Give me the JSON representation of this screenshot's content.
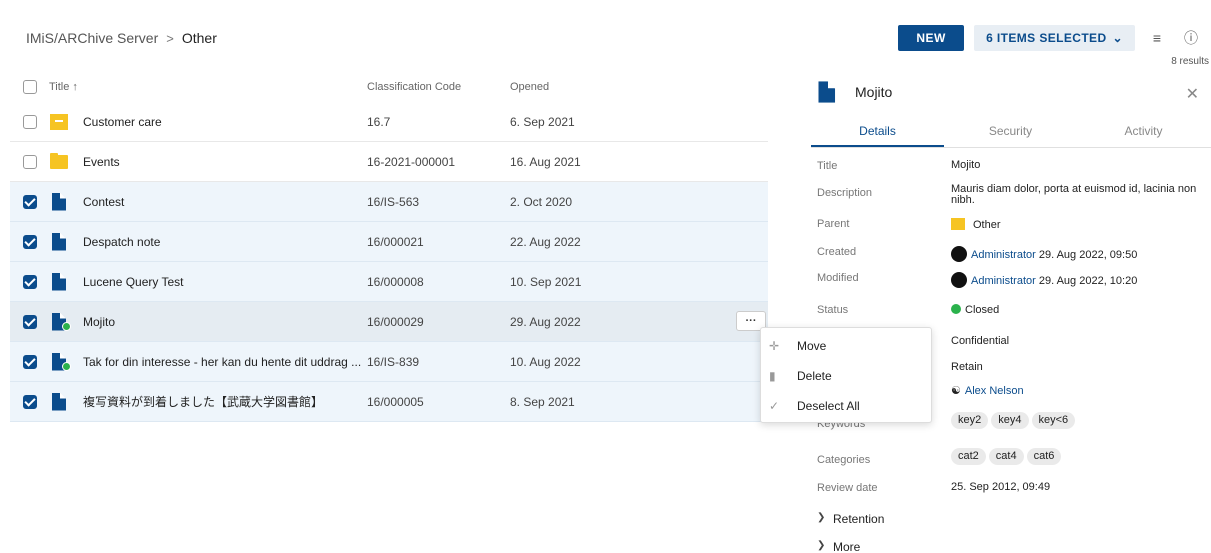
{
  "breadcrumb": {
    "root": "IMiS/ARChive Server",
    "separator": ">",
    "current": "Other"
  },
  "toolbar": {
    "new_label": "NEW",
    "selected_label": "6 ITEMS SELECTED",
    "results": "8 results"
  },
  "table": {
    "headers": {
      "title": "Title ↑",
      "code": "Classification Code",
      "opened": "Opened"
    },
    "rows": [
      {
        "title": "Customer care",
        "code": "16.7",
        "opened": "6. Sep 2021"
      },
      {
        "title": "Events",
        "code": "16-2021-000001",
        "opened": "16. Aug 2021"
      },
      {
        "title": "Contest",
        "code": "16/IS-563",
        "opened": "2. Oct 2020"
      },
      {
        "title": "Despatch note",
        "code": "16/000021",
        "opened": "22. Aug 2022"
      },
      {
        "title": "Lucene Query Test",
        "code": "16/000008",
        "opened": "10. Sep 2021"
      },
      {
        "title": "Mojito",
        "code": "16/000029",
        "opened": "29. Aug 2022"
      },
      {
        "title": "Tak for din interesse - her kan du hente dit uddrag ...",
        "code": "16/IS-839",
        "opened": "10. Aug 2022"
      },
      {
        "title": "複写資料が到着しました【武蔵大学図書館】",
        "code": "16/000005",
        "opened": "8. Sep 2021"
      }
    ],
    "more_label": "···"
  },
  "context_menu": {
    "move": "Move",
    "delete": "Delete",
    "deselect": "Deselect All"
  },
  "panel": {
    "title": "Mojito",
    "tabs": {
      "details": "Details",
      "security": "Security",
      "activity": "Activity"
    },
    "props": {
      "title_l": "Title",
      "title_v": "Mojito",
      "desc_l": "Description",
      "desc_v": "Mauris diam dolor, porta at euismod id, lacinia non nibh.",
      "parent_l": "Parent",
      "parent_v": "Other",
      "created_l": "Created",
      "created_user": "Administrator",
      "created_v": "29. Aug 2022, 09:50",
      "modified_l": "Modified",
      "modified_user": "Administrator",
      "modified_v": "29. Aug 2022, 10:20",
      "status_l": "Status",
      "status_v": "Closed",
      "security_v": "Confidential",
      "retain_v": "Retain",
      "owner_v": "Alex Nelson",
      "keywords_l": "Keywords",
      "keywords": [
        "key2",
        "key4",
        "key<6"
      ],
      "categories_l": "Categories",
      "categories": [
        "cat2",
        "cat4",
        "cat6"
      ],
      "review_l": "Review date",
      "review_v": "25. Sep 2012, 09:49",
      "retention_l": "Retention",
      "more_l": "More"
    }
  }
}
